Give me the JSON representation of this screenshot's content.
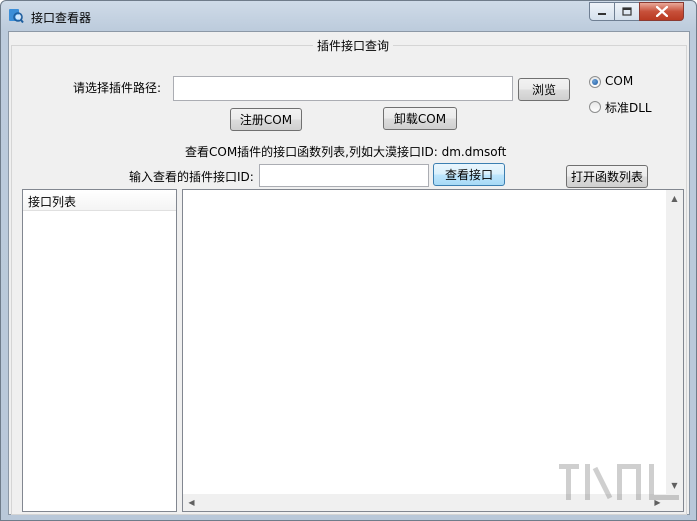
{
  "window": {
    "title": "接口查看器",
    "minimize_icon": "minimize-icon",
    "maximize_icon": "maximize-icon",
    "close_icon": "close-icon"
  },
  "group": {
    "title": "插件接口查询"
  },
  "path": {
    "label": "请选择插件路径:",
    "value": "",
    "browse_label": "浏览"
  },
  "mode": {
    "options": [
      "COM",
      "标准DLL"
    ],
    "selected": "COM"
  },
  "buttons": {
    "register": "注册COM",
    "unregister": "卸载COM",
    "view_interface": "查看接口",
    "open_function_list": "打开函数列表"
  },
  "hint": {
    "text": "查看COM插件的接口函数列表,列如大漠接口ID: dm.dmsoft"
  },
  "interface_id": {
    "label": "输入查看的插件接口ID:",
    "value": ""
  },
  "list": {
    "header": "接口列表",
    "items": []
  },
  "output": {
    "content": ""
  },
  "colors": {
    "client_bg": "#f0f0f0",
    "titlebar": "#c4d3e3",
    "close_button": "#c7503a",
    "focus_border": "#3c7fb1"
  }
}
